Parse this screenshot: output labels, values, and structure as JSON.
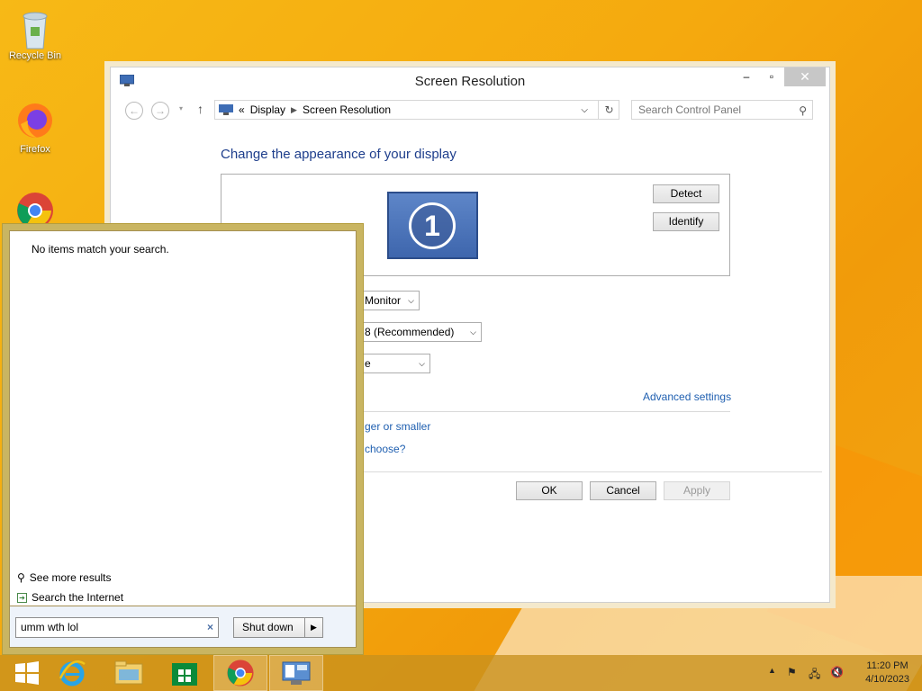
{
  "desktop": {
    "icons": [
      {
        "label": "Recycle Bin"
      },
      {
        "label": "Firefox"
      }
    ]
  },
  "window": {
    "title": "Screen Resolution",
    "nav": {
      "breadcrumb_prefix": "«",
      "breadcrumbs": [
        "Display",
        "Screen Resolution"
      ],
      "search_placeholder": "Search Control Panel"
    },
    "heading": "Change the appearance of your display",
    "monitor_number": "1",
    "buttons": {
      "detect": "Detect",
      "identify": "Identify",
      "ok": "OK",
      "cancel": "Cancel",
      "apply": "Apply"
    },
    "selects": {
      "display": "Monitor",
      "resolution": "8 (Recommended)",
      "orientation": "e"
    },
    "links": {
      "advanced": "Advanced settings",
      "larger_smaller": "ger or smaller",
      "choose": "choose?"
    }
  },
  "search_pane": {
    "no_items": "No items match your search.",
    "see_more": "See more results",
    "search_internet": "Search the Internet",
    "query": "umm wth lol",
    "shutdown": "Shut down"
  },
  "taskbar": {
    "clock_time": "11:20 PM",
    "clock_date": "4/10/2023"
  }
}
